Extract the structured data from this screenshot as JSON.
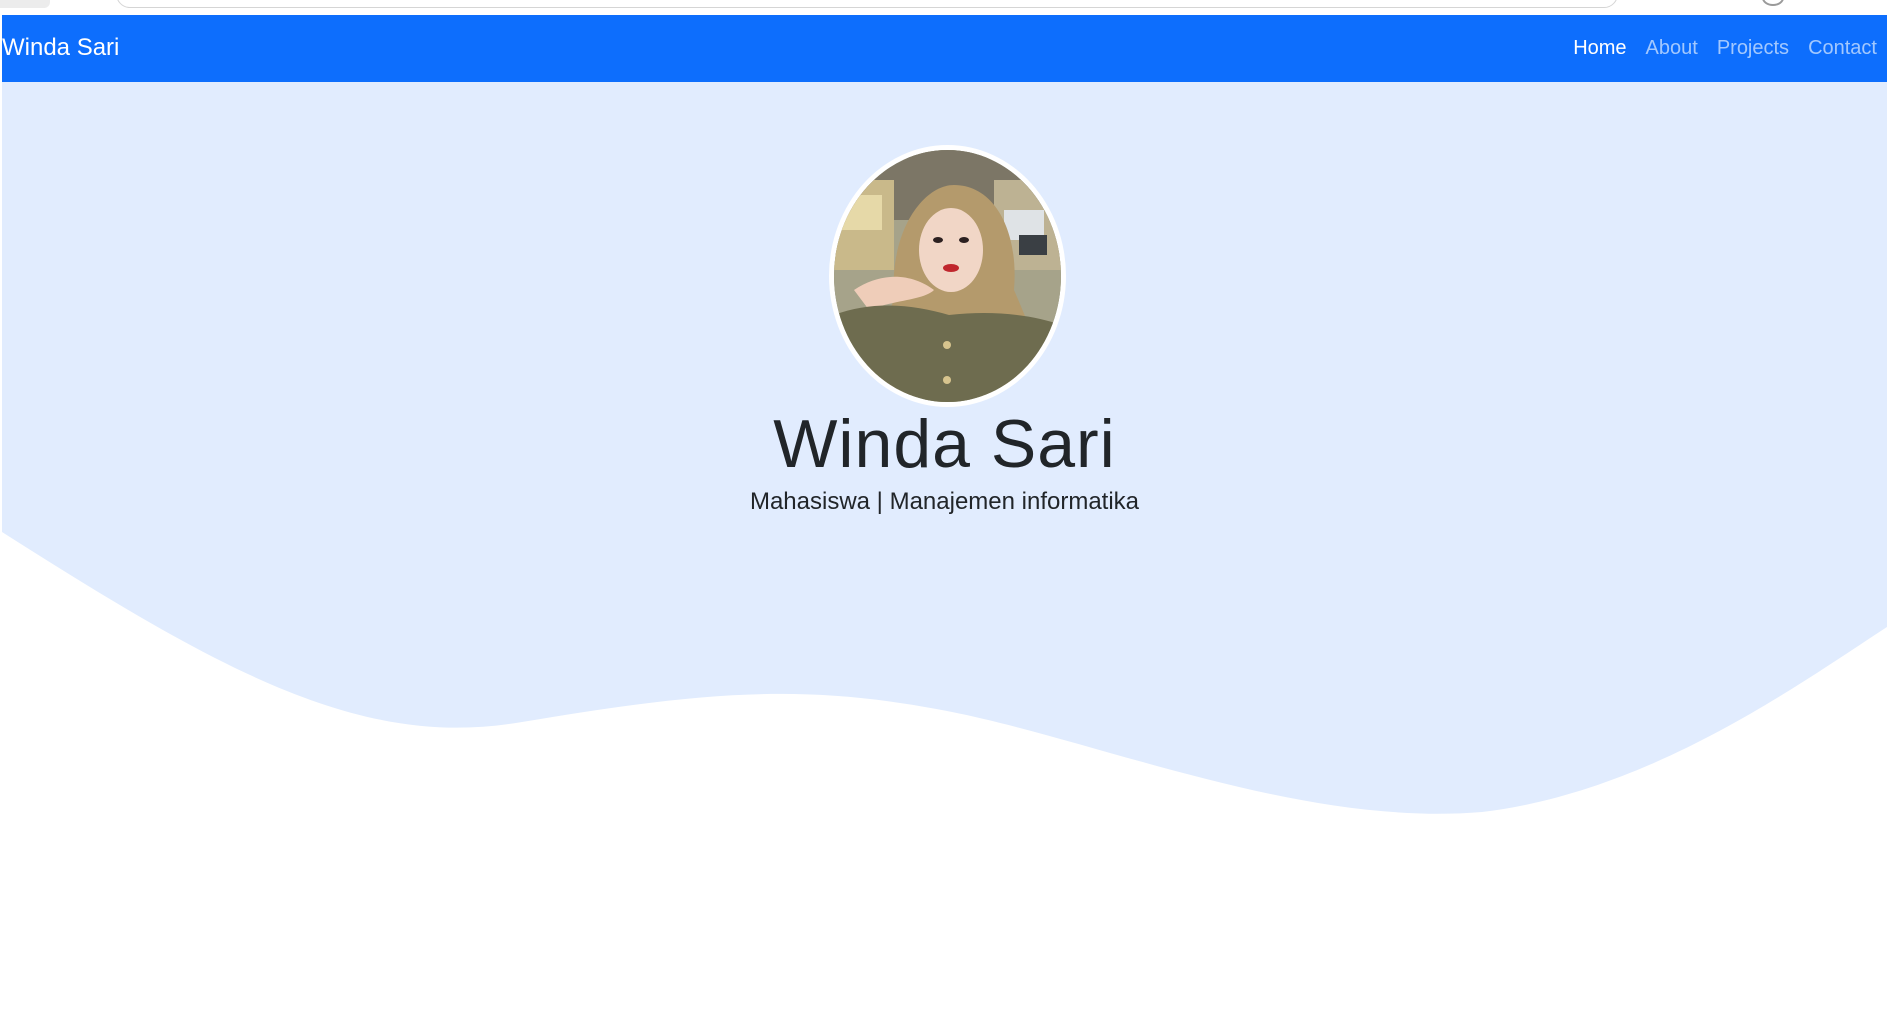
{
  "navbar": {
    "brand": "Winda Sari",
    "links": [
      {
        "label": "Home",
        "active": true
      },
      {
        "label": "About",
        "active": false
      },
      {
        "label": "Projects",
        "active": false
      },
      {
        "label": "Contact",
        "active": false
      }
    ],
    "color": "#0d6efd"
  },
  "hero": {
    "title": "Winda Sari",
    "subtitle": "Mahasiswa | Manajemen informatika",
    "background_color": "#e1ecfe",
    "avatar": "profile-photo"
  }
}
